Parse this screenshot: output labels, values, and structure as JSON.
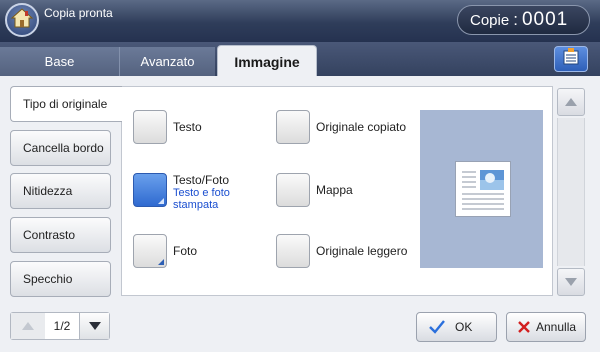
{
  "header": {
    "status": "Copia pronta",
    "copies_label": "Copie",
    "copies_separator": ":",
    "copies_value": "0001"
  },
  "tabs": [
    {
      "label": "Base"
    },
    {
      "label": "Avanzato"
    },
    {
      "label": "Immagine",
      "active": true
    }
  ],
  "sidebar": {
    "items": [
      {
        "label": "Tipo di originale",
        "selected": true
      },
      {
        "label": "Cancella bordo"
      },
      {
        "label": "Nitidezza"
      },
      {
        "label": "Contrasto"
      },
      {
        "label": "Specchio"
      }
    ]
  },
  "options": [
    {
      "label": "Testo",
      "sub": ""
    },
    {
      "label": "Testo/Foto",
      "sub": "Testo e foto stampata",
      "selected": true
    },
    {
      "label": "Foto",
      "sub": ""
    },
    {
      "label": "Originale copiato",
      "sub": ""
    },
    {
      "label": "Mappa",
      "sub": ""
    },
    {
      "label": "Originale leggero",
      "sub": ""
    }
  ],
  "pager": {
    "text": "1/2"
  },
  "actions": {
    "ok": "OK",
    "cancel": "Annulla"
  },
  "icons": {
    "home": "home-icon",
    "job": "job-status-icon",
    "ok": "checkmark-icon",
    "cancel": "x-icon",
    "preview": "document-preview-icon"
  },
  "colors": {
    "accent": "#2f6ad0",
    "header": "#2f3d5a",
    "preview_bg": "#a7b7d3",
    "cancel_x": "#d21f1f",
    "ok_check": "#2a6fdc"
  }
}
